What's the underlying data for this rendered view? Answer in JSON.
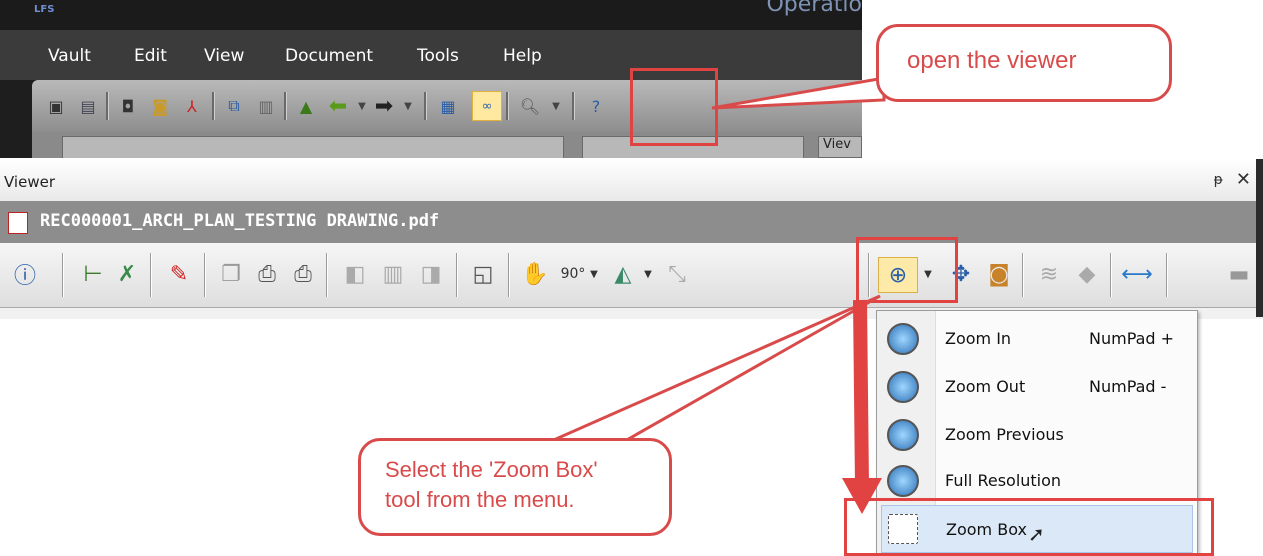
{
  "vault": {
    "title": "Operatio",
    "logo": "LFS",
    "menu": [
      "Vault",
      "Edit",
      "View",
      "Document",
      "Tools",
      "Help"
    ],
    "partial_tab_label": "Viev"
  },
  "viewer": {
    "panel_title": "Viewer",
    "pin_icon": "ᵽ",
    "close_icon": "✕",
    "document_name": "REC000001_ARCH_PLAN_TESTING DRAWING.pdf"
  },
  "zoom_menu": {
    "items": [
      {
        "label": "Zoom In",
        "shortcut": "NumPad +",
        "icon": "zoom-in-icon"
      },
      {
        "label": "Zoom Out",
        "shortcut": "NumPad -",
        "icon": "zoom-out-icon"
      },
      {
        "label": "Zoom Previous",
        "shortcut": "",
        "icon": "zoom-previous-icon"
      },
      {
        "label": "Full Resolution",
        "shortcut": "",
        "icon": "full-resolution-icon"
      },
      {
        "label": "Zoom Box",
        "shortcut": "",
        "icon": "zoom-box-icon"
      }
    ]
  },
  "callouts": {
    "viewer": "open the viewer",
    "zoom_box_line1": "Select the 'Zoom Box'",
    "zoom_box_line2": "tool from the menu."
  },
  "colors": {
    "callout_red": "#d94b4b",
    "highlight_red": "#e14242",
    "vault_dark": "#1e1e1e",
    "menu_hover": "#dbe8f7"
  }
}
